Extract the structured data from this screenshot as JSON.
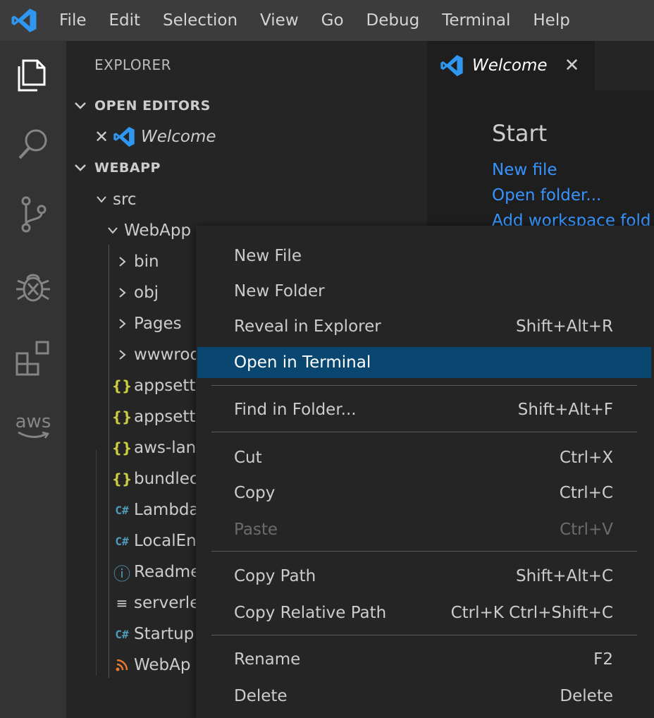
{
  "menubar": [
    "File",
    "Edit",
    "Selection",
    "View",
    "Go",
    "Debug",
    "Terminal",
    "Help"
  ],
  "activity_bar": {
    "aws_label": "aws"
  },
  "sidebar": {
    "title": "EXPLORER",
    "open_editors": {
      "header": "OPEN EDITORS",
      "items": [
        {
          "label": "Welcome"
        }
      ]
    },
    "workspace": {
      "header": "WEBAPP",
      "tree": [
        {
          "label": "src",
          "kind": "folder-open"
        },
        {
          "label": "WebApp",
          "kind": "folder-open"
        },
        {
          "label": "bin",
          "kind": "folder"
        },
        {
          "label": "obj",
          "kind": "folder"
        },
        {
          "label": "Pages",
          "kind": "folder"
        },
        {
          "label": "wwwroo",
          "kind": "folder"
        },
        {
          "label": "appsett",
          "kind": "json"
        },
        {
          "label": "appsett",
          "kind": "json"
        },
        {
          "label": "aws-lan",
          "kind": "json"
        },
        {
          "label": "bundlec",
          "kind": "json"
        },
        {
          "label": "Lambda",
          "kind": "csharp"
        },
        {
          "label": "LocalEn",
          "kind": "csharp"
        },
        {
          "label": "Readme",
          "kind": "info"
        },
        {
          "label": "serverle",
          "kind": "text"
        },
        {
          "label": "Startup",
          "kind": "csharp"
        },
        {
          "label": "WebAp",
          "kind": "rss"
        }
      ]
    }
  },
  "editor": {
    "tab": {
      "label": "Welcome",
      "close_glyph": "✕"
    },
    "welcome": {
      "start_heading": "Start",
      "links": [
        "New file",
        "Open folder...",
        "Add workspace fold"
      ]
    }
  },
  "context_menu": {
    "items": [
      {
        "label": "New File",
        "shortcut": ""
      },
      {
        "label": "New Folder",
        "shortcut": ""
      },
      {
        "label": "Reveal in Explorer",
        "shortcut": "Shift+Alt+R"
      },
      {
        "label": "Open in Terminal",
        "shortcut": "",
        "active": true
      },
      {
        "label": "Find in Folder...",
        "shortcut": "Shift+Alt+F"
      },
      {
        "label": "Cut",
        "shortcut": "Ctrl+X"
      },
      {
        "label": "Copy",
        "shortcut": "Ctrl+C"
      },
      {
        "label": "Paste",
        "shortcut": "Ctrl+V",
        "disabled": true
      },
      {
        "label": "Copy Path",
        "shortcut": "Shift+Alt+C"
      },
      {
        "label": "Copy Relative Path",
        "shortcut": "Ctrl+K Ctrl+Shift+C"
      },
      {
        "label": "Rename",
        "shortcut": "F2"
      },
      {
        "label": "Delete",
        "shortcut": "Delete"
      }
    ]
  },
  "colors": {
    "accent": "#007acc",
    "selection": "#094771",
    "link": "#3794ff",
    "vscode_blue": "#2f97f0"
  },
  "icons": {
    "json": "{}",
    "csharp": "C#",
    "info": "ⓘ",
    "text": "≡",
    "rss": "rss"
  }
}
